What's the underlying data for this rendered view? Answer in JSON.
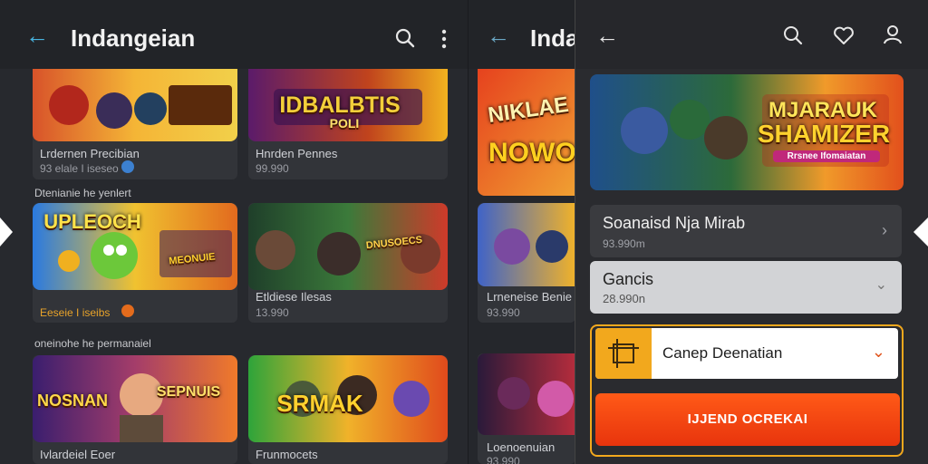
{
  "left": {
    "title": "Indangeian",
    "sections": [
      "Dtenianie he yenlert",
      "oneinohe he permanaiel"
    ],
    "cards": [
      {
        "art": "",
        "title": "Lrdernen Precibian",
        "meta": "93 elale I iseseo"
      },
      {
        "art": "IDBALBTIS",
        "sub": "POLI",
        "title": "Hnrden Pennes",
        "meta": "99.990"
      },
      {
        "art": "UPLEOCH",
        "sub": "MEONUIE",
        "title": "",
        "meta": "Eeseie I iseibs"
      },
      {
        "art": "",
        "sub": "DNUSOECS",
        "title": "Etldiese Ilesas",
        "meta": "13.990"
      },
      {
        "art": "NOSNAN",
        "sub": "SEPNUIS",
        "title": "Ivlardeiel Eoer",
        "meta": ""
      },
      {
        "art": "SRMAK",
        "title": "Frunmocets",
        "meta": ""
      }
    ]
  },
  "mid": {
    "title": "Indangeian",
    "cards": [
      {
        "art": "NIKLAE",
        "sub": "NOWO",
        "title": "",
        "meta": ""
      },
      {
        "art": "",
        "title": "Lrneneise Benie",
        "meta": "93.990"
      },
      {
        "art": "",
        "title": "Loenoenuian",
        "meta": "93.990"
      }
    ]
  },
  "right": {
    "hero_art": "MJARAUK",
    "hero_art2": "SHAMIZER",
    "hero_art3": "Rrsnee Ifomaiatan",
    "item1": {
      "title": "Soanaisd Nja Mirab",
      "meta": "93.990m"
    },
    "item2": {
      "title": "Gancis",
      "meta": "28.990n"
    },
    "dropdown": {
      "label": "Canep Deenatian"
    },
    "action_label": "IJJEND OCREKAI"
  },
  "colors": {
    "accent_blue": "#48b4e0",
    "orange": "#ff5a17",
    "frame_orange": "#f2a81d"
  }
}
